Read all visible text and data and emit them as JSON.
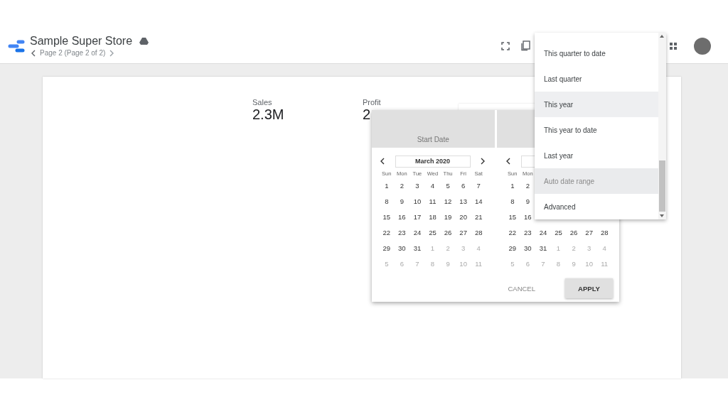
{
  "header": {
    "title": "Sample Super Store",
    "page_nav": "Page 2 (Page 2 of 2)"
  },
  "scorecards": [
    {
      "label": "Sales",
      "value": "2.3M"
    },
    {
      "label": "Profit",
      "value": "2"
    }
  ],
  "date_picker": {
    "start_label": "Start Date",
    "calendars": [
      {
        "month": "March 2020",
        "day_headers": [
          "Sun",
          "Mon",
          "Tue",
          "Wed",
          "Thu",
          "Fri",
          "Sat"
        ],
        "weeks": [
          [
            {
              "day": "1",
              "outside": false
            },
            {
              "day": "2",
              "outside": false
            },
            {
              "day": "3",
              "outside": false
            },
            {
              "day": "4",
              "outside": false
            },
            {
              "day": "5",
              "outside": false
            },
            {
              "day": "6",
              "outside": false
            },
            {
              "day": "7",
              "outside": false
            }
          ],
          [
            {
              "day": "8",
              "outside": false
            },
            {
              "day": "9",
              "outside": false
            },
            {
              "day": "10",
              "outside": false
            },
            {
              "day": "11",
              "outside": false
            },
            {
              "day": "12",
              "outside": false
            },
            {
              "day": "13",
              "outside": false
            },
            {
              "day": "14",
              "outside": false
            }
          ],
          [
            {
              "day": "15",
              "outside": false
            },
            {
              "day": "16",
              "outside": false
            },
            {
              "day": "17",
              "outside": false
            },
            {
              "day": "18",
              "outside": false
            },
            {
              "day": "19",
              "outside": false
            },
            {
              "day": "20",
              "outside": false
            },
            {
              "day": "21",
              "outside": false
            }
          ],
          [
            {
              "day": "22",
              "outside": false
            },
            {
              "day": "23",
              "outside": false
            },
            {
              "day": "24",
              "outside": false
            },
            {
              "day": "25",
              "outside": false
            },
            {
              "day": "26",
              "outside": false
            },
            {
              "day": "27",
              "outside": false
            },
            {
              "day": "28",
              "outside": false
            }
          ],
          [
            {
              "day": "29",
              "outside": false
            },
            {
              "day": "30",
              "outside": false
            },
            {
              "day": "31",
              "outside": false
            },
            {
              "day": "1",
              "outside": true
            },
            {
              "day": "2",
              "outside": true
            },
            {
              "day": "3",
              "outside": true
            },
            {
              "day": "4",
              "outside": true
            }
          ],
          [
            {
              "day": "5",
              "outside": true
            },
            {
              "day": "6",
              "outside": true
            },
            {
              "day": "7",
              "outside": true
            },
            {
              "day": "8",
              "outside": true
            },
            {
              "day": "9",
              "outside": true
            },
            {
              "day": "10",
              "outside": true
            },
            {
              "day": "11",
              "outside": true
            }
          ]
        ]
      },
      {
        "day_headers": [
          "Sun",
          "Mon"
        ],
        "weeks": [
          [
            {
              "day": "1",
              "outside": false
            },
            {
              "day": "2",
              "outside": false
            }
          ],
          [
            {
              "day": "8",
              "outside": false
            },
            {
              "day": "9",
              "outside": false
            }
          ],
          [
            {
              "day": "15",
              "outside": false
            },
            {
              "day": "16",
              "outside": false
            }
          ],
          [
            {
              "day": "22",
              "outside": false
            },
            {
              "day": "23",
              "outside": false
            },
            {
              "day": "24",
              "outside": false
            },
            {
              "day": "25",
              "outside": false
            },
            {
              "day": "26",
              "outside": false
            },
            {
              "day": "27",
              "outside": false
            },
            {
              "day": "28",
              "outside": false
            }
          ],
          [
            {
              "day": "29",
              "outside": false
            },
            {
              "day": "30",
              "outside": false
            },
            {
              "day": "31",
              "outside": false
            },
            {
              "day": "1",
              "outside": true
            },
            {
              "day": "2",
              "outside": true
            },
            {
              "day": "3",
              "outside": true
            },
            {
              "day": "4",
              "outside": true
            }
          ],
          [
            {
              "day": "5",
              "outside": true
            },
            {
              "day": "6",
              "outside": true
            },
            {
              "day": "7",
              "outside": true
            },
            {
              "day": "8",
              "outside": true
            },
            {
              "day": "9",
              "outside": true
            },
            {
              "day": "10",
              "outside": true
            },
            {
              "day": "11",
              "outside": true
            }
          ]
        ]
      }
    ],
    "buttons": [
      {
        "label": "CANCEL",
        "kind": "flat"
      },
      {
        "label": "APPLY",
        "kind": "raised"
      }
    ]
  },
  "range_menu": {
    "items": [
      {
        "label": "This quarter to date",
        "selected": false,
        "hovered": false
      },
      {
        "label": "Last quarter",
        "selected": false,
        "hovered": false
      },
      {
        "label": "This year",
        "selected": false,
        "hovered": true
      },
      {
        "label": "This year to date",
        "selected": false,
        "hovered": false
      },
      {
        "label": "Last year",
        "selected": false,
        "hovered": false
      },
      {
        "label": "Auto date range",
        "selected": true,
        "hovered": false
      },
      {
        "label": "Advanced",
        "selected": false,
        "hovered": false
      }
    ]
  }
}
